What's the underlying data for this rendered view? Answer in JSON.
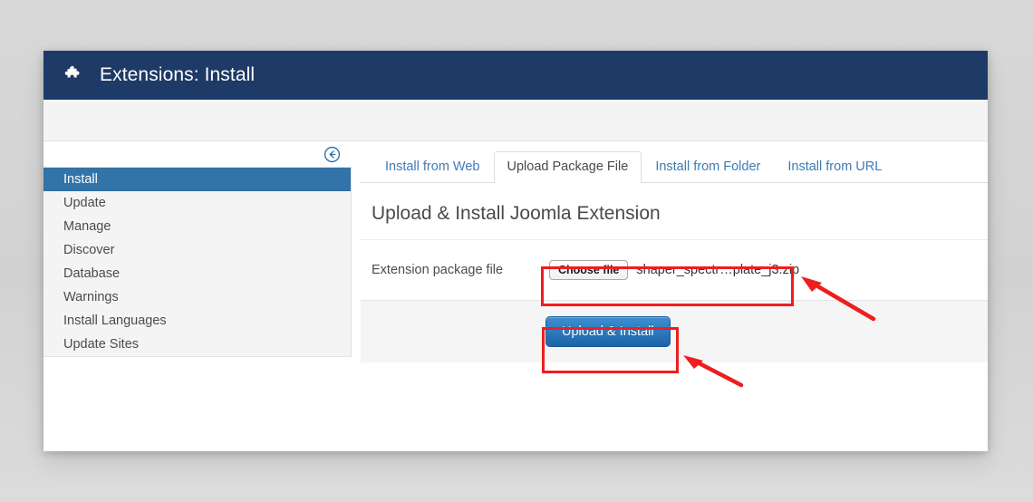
{
  "header": {
    "icon": "puzzle-piece-icon",
    "title": "Extensions: Install"
  },
  "sidebar": {
    "collapse_icon": "circle-arrow-left-icon",
    "items": [
      {
        "label": "Install",
        "active": true
      },
      {
        "label": "Update",
        "active": false
      },
      {
        "label": "Manage",
        "active": false
      },
      {
        "label": "Discover",
        "active": false
      },
      {
        "label": "Database",
        "active": false
      },
      {
        "label": "Warnings",
        "active": false
      },
      {
        "label": "Install Languages",
        "active": false
      },
      {
        "label": "Update Sites",
        "active": false
      }
    ]
  },
  "tabs": [
    {
      "label": "Install from Web",
      "active": false
    },
    {
      "label": "Upload Package File",
      "active": true
    },
    {
      "label": "Install from Folder",
      "active": false
    },
    {
      "label": "Install from URL",
      "active": false
    }
  ],
  "panel": {
    "heading": "Upload & Install Joomla Extension",
    "form": {
      "file_label": "Extension package file",
      "choose_file_button": "Choose file",
      "file_name": "shaper_spectr…plate_j3.zip"
    },
    "submit_button": "Upload & Install"
  },
  "annotations": {
    "accent_color": "#ef1d1d",
    "highlight_file_field": true,
    "highlight_submit_button": true,
    "arrow_file_field": "arrow-pointing-to-file-field",
    "arrow_submit_button": "arrow-pointing-to-submit-button"
  },
  "colors": {
    "page_background": "#d4d4d4",
    "header_blue": "#1e3a66",
    "sidebar_active_blue": "#3273a8",
    "tab_link_blue": "#3d7cb8",
    "primary_button_blue": "#1c63a8"
  }
}
